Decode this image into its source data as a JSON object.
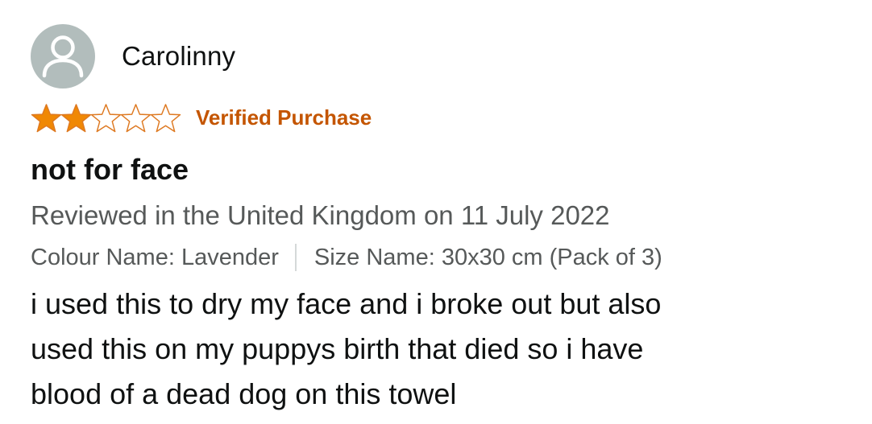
{
  "profile": {
    "name": "Carolinny",
    "avatar_icon": "default-user-icon",
    "avatar_color": "#b2bdbc"
  },
  "rating": {
    "value": 2,
    "max": 5,
    "star_fill_color": "#f08804",
    "star_outline_color": "#de7921"
  },
  "badge": {
    "verified_label": "Verified Purchase",
    "color": "#c45500"
  },
  "review": {
    "title": "not for face",
    "reviewed_line": "Reviewed in the United Kingdom on 11 July 2022",
    "colour_name": "Colour Name: Lavender",
    "size_name": "Size Name: 30x30 cm (Pack of 3)",
    "body_lines": [
      "i used this to dry my face and i broke out but also",
      "used this on my puppys birth that died so i have",
      "blood of a dead dog on this towel"
    ]
  }
}
